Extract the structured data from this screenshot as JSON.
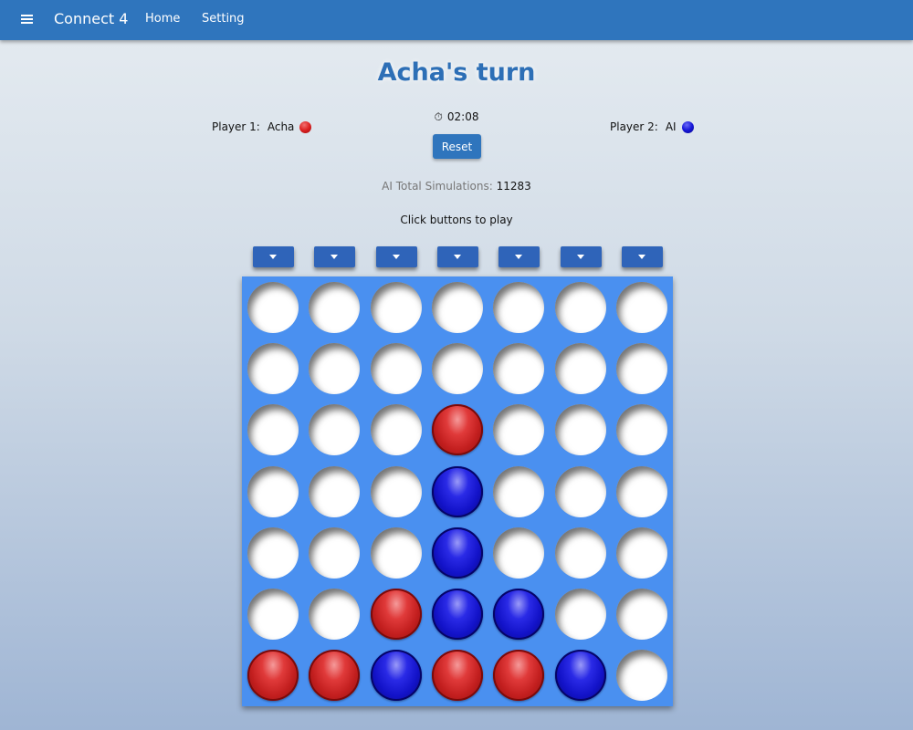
{
  "nav": {
    "brand": "Connect 4",
    "links": [
      "Home",
      "Setting"
    ]
  },
  "status": {
    "turn_title": "Acha's turn",
    "timer": "02:08",
    "reset_label": "Reset",
    "simulations_label": "AI Total Simulations:",
    "simulations_value": "11283",
    "hint": "Click buttons to play"
  },
  "players": {
    "player1": {
      "label": "Player 1:",
      "name": "Acha",
      "color": "#d22222"
    },
    "player2": {
      "label": "Player 2:",
      "name": "AI",
      "color": "#1717d8"
    }
  },
  "board": {
    "columns": 7,
    "rows": 7,
    "board_color": "#4a90f0",
    "cells": [
      [
        "empty",
        "empty",
        "empty",
        "empty",
        "empty",
        "empty",
        "empty"
      ],
      [
        "empty",
        "empty",
        "empty",
        "empty",
        "empty",
        "empty",
        "empty"
      ],
      [
        "empty",
        "empty",
        "empty",
        "red",
        "empty",
        "empty",
        "empty"
      ],
      [
        "empty",
        "empty",
        "empty",
        "blue",
        "empty",
        "empty",
        "empty"
      ],
      [
        "empty",
        "empty",
        "empty",
        "blue",
        "empty",
        "empty",
        "empty"
      ],
      [
        "empty",
        "empty",
        "red",
        "blue",
        "blue",
        "empty",
        "empty"
      ],
      [
        "red",
        "red",
        "blue",
        "red",
        "red",
        "blue",
        "empty"
      ]
    ]
  },
  "icons": {
    "menu": "hamburger-icon",
    "timer": "stopwatch-icon",
    "drop": "arrow-down-icon"
  }
}
